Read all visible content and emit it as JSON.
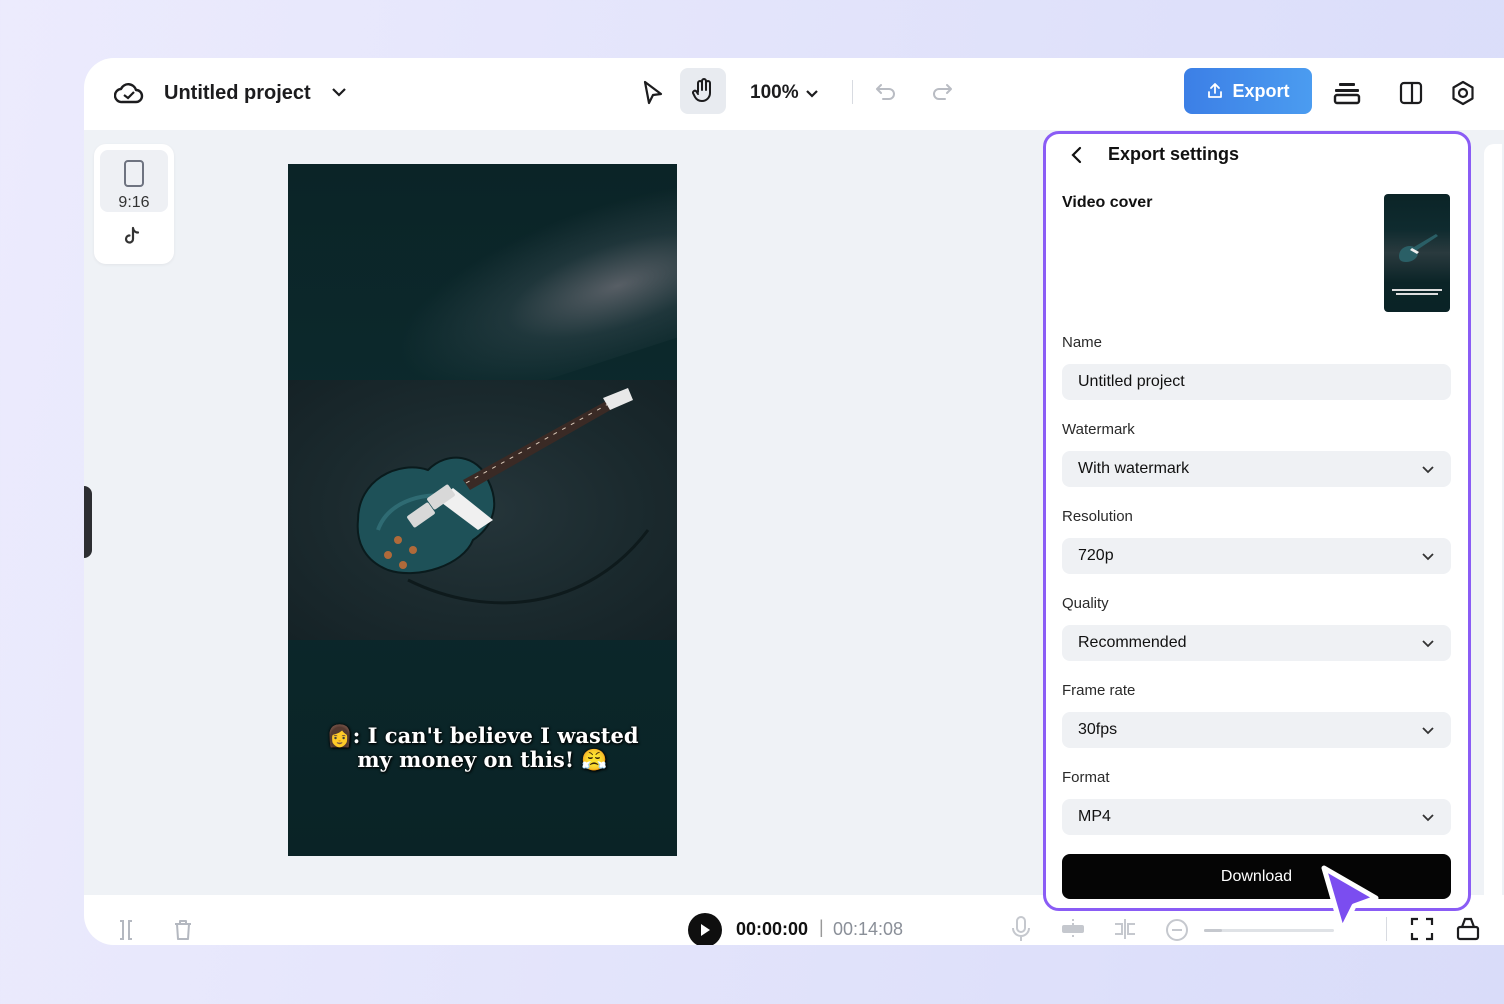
{
  "topbar": {
    "project_title": "Untitled project",
    "zoom": "100%",
    "export_label": "Export"
  },
  "ratio": {
    "label": "9:16"
  },
  "preview": {
    "caption_line1": "👩: I can't believe I wasted",
    "caption_line2": "my money on this! 😤"
  },
  "playback": {
    "current_time": "00:00:00",
    "separator": "|",
    "total_time": "00:14:08"
  },
  "export_panel": {
    "title": "Export settings",
    "video_cover_label": "Video cover",
    "name_label": "Name",
    "name_value": "Untitled project",
    "watermark_label": "Watermark",
    "watermark_value": "With watermark",
    "resolution_label": "Resolution",
    "resolution_value": "720p",
    "quality_label": "Quality",
    "quality_value": "Recommended",
    "framerate_label": "Frame rate",
    "framerate_value": "30fps",
    "format_label": "Format",
    "format_value": "MP4",
    "download_label": "Download"
  },
  "colors": {
    "accent_blue": "#3c7fe6",
    "panel_border": "#8a5cf5",
    "cursor": "#7b4df0"
  },
  "icons": [
    "cloud-icon",
    "chevron-down-icon",
    "pointer-icon",
    "hand-icon",
    "undo-icon",
    "redo-icon",
    "upload-icon",
    "layers-icon",
    "split-view-icon",
    "settings-icon",
    "phone-frame-icon",
    "tiktok-icon",
    "back-icon",
    "play-icon",
    "mic-icon",
    "trim-icon",
    "split-icon",
    "zoom-out-icon",
    "fullscreen-icon",
    "lock-icon",
    "cursor-icon",
    "trash-icon",
    "bracket-icon"
  ]
}
